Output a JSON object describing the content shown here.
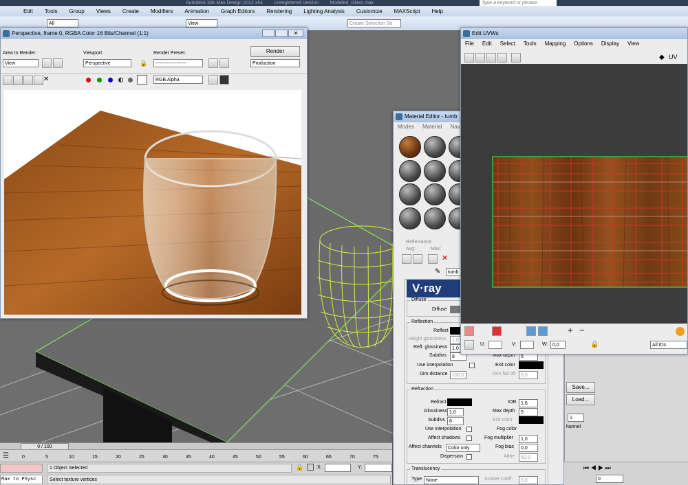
{
  "app": {
    "title_a": "Autodesk 3ds Max Design 2012 x64",
    "title_b": "Unregistered Version",
    "title_c": "Modeled_Glass.max",
    "search_placeholder": "Type a keyword or phrase"
  },
  "main_menu": [
    "Edit",
    "Tools",
    "Group",
    "Views",
    "Create",
    "Modifiers",
    "Animation",
    "Graph Editors",
    "Rendering",
    "Lighting Analysis",
    "Customize",
    "MAXScript",
    "Help"
  ],
  "toolbar": {
    "filter": "All",
    "viewport": "View",
    "selection_set": "Create Selection Se"
  },
  "render_frame": {
    "title": "Perspective, frame 0, RGBA Color 16 Bits/Channel (1:1)",
    "area_label": "Area to Render:",
    "area_value": "View",
    "viewport_label": "Viewport:",
    "viewport_value": "Perspective",
    "preset_label": "Render Preset:",
    "preset_value": "-------------------",
    "render_button": "Render",
    "production_value": "Production",
    "channel_value": "RGB Alpha"
  },
  "edit_uvws": {
    "title": "Edit UVWs",
    "menu": [
      "File",
      "Edit",
      "Select",
      "Tools",
      "Mapping",
      "Options",
      "Display",
      "View"
    ],
    "uv_label": "UV",
    "u_label": "U:",
    "v_label": "V:",
    "w_label": "W:",
    "w_value": "0,0",
    "ids_value": "All IDs"
  },
  "material_editor": {
    "title": "Material Editor - tumb",
    "menu": [
      "Modes",
      "Material",
      "Navi"
    ],
    "reflectance": "Reflectance",
    "avg": "Avg:",
    "max": "Max:",
    "mat_name": "tumb",
    "brand": "V·ray",
    "diffuse_group": "Diffuse",
    "diffuse_label": "Diffuse",
    "reflection_group": "Reflection",
    "reflect_label": "Reflect",
    "hilight_label": "Hilight glossiness",
    "hilight_value": "1,0",
    "refl_gloss_label": "Refl. glossiness",
    "refl_gloss_value": "1,0",
    "subdivs_label": "Subdivs",
    "subdivs_value": "8",
    "max_depth_label": "Max depth",
    "max_depth_value": "5",
    "use_interp_label": "Use interpolation",
    "exit_color_label": "Exit color",
    "dim_dist_label": "Dim distance",
    "dim_dist_value": "100,0",
    "dim_falloff_label": "Dim fall off",
    "dim_falloff_value": "0,0",
    "refraction_group": "Refraction",
    "refract_label": "Refract",
    "ior_label": "IOR",
    "ior_value": "1,6",
    "gloss_label": "Glossiness",
    "gloss_value": "1,0",
    "r_max_depth_value": "5",
    "r_subdivs_value": "8",
    "r_exit_color_label": "Exit color",
    "r_use_interp_label": "Use interpolation",
    "fog_color_label": "Fog color",
    "affect_shadows_label": "Affect shadows",
    "fog_mult_label": "Fog multiplier",
    "fog_mult_value": "1,0",
    "affect_channels_label": "Affect channels",
    "affect_channels_value": "Color only",
    "fog_bias_label": "Fog bias",
    "fog_bias_value": "0,0",
    "dispersion_label": "Dispersion",
    "abbe_label": "Abbe",
    "abbe_value": "50,0",
    "translucency_group": "Translucency",
    "type_label": "Type",
    "type_value": "None",
    "scatter_label": "Scatter coeff",
    "scatter_value": "0,0"
  },
  "right_panel": {
    "save": "Save...",
    "load": "Load...",
    "spinner_value": "1",
    "channel": "hannel",
    "frame_value": "0"
  },
  "timeline": {
    "frame_display": "0 / 100",
    "ticks": [
      "0",
      "5",
      "10",
      "15",
      "20",
      "25",
      "30",
      "35",
      "40",
      "45",
      "50",
      "55",
      "60",
      "65",
      "70",
      "75"
    ]
  },
  "status": {
    "selected": "1 Object Selected",
    "prompt": "Select texture vertices",
    "script": "Max to Physc",
    "x_label": "X:",
    "y_label": "Y:"
  }
}
